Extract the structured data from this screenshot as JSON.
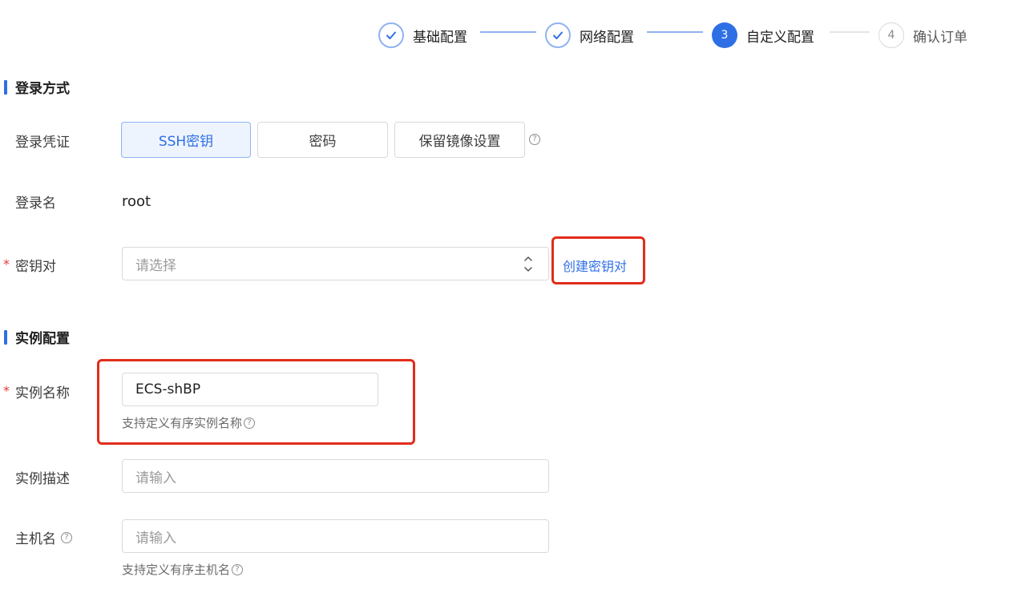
{
  "stepper": {
    "steps": [
      {
        "label": "基础配置",
        "status": "done",
        "num": ""
      },
      {
        "label": "网络配置",
        "status": "done",
        "num": ""
      },
      {
        "label": "自定义配置",
        "status": "current",
        "num": "3"
      },
      {
        "label": "确认订单",
        "status": "pending",
        "num": "4"
      }
    ]
  },
  "login_section": {
    "title": "登录方式",
    "credential_label": "登录凭证",
    "credential_options": [
      "SSH密钥",
      "密码",
      "保留镜像设置"
    ],
    "credential_selected": "SSH密钥",
    "login_name_label": "登录名",
    "login_name_value": "root",
    "keypair_label": "密钥对",
    "keypair_placeholder": "请选择",
    "create_keypair_link": "创建密钥对",
    "required_mark": "*"
  },
  "instance_section": {
    "title": "实例配置",
    "name_label": "实例名称",
    "name_value": "ECS-shBP",
    "name_hint": "支持定义有序实例名称",
    "desc_label": "实例描述",
    "desc_placeholder": "请输入",
    "host_label": "主机名",
    "host_placeholder": "请输入",
    "host_hint": "支持定义有序主机名",
    "required_mark": "*"
  },
  "icons": {
    "check": "check-icon",
    "help": "question-circle-icon",
    "select_arrows": "chevron-up-down-icon"
  },
  "colors": {
    "primary": "#2f6fe6",
    "highlight_box": "#e02d1b",
    "required": "#e53935"
  }
}
